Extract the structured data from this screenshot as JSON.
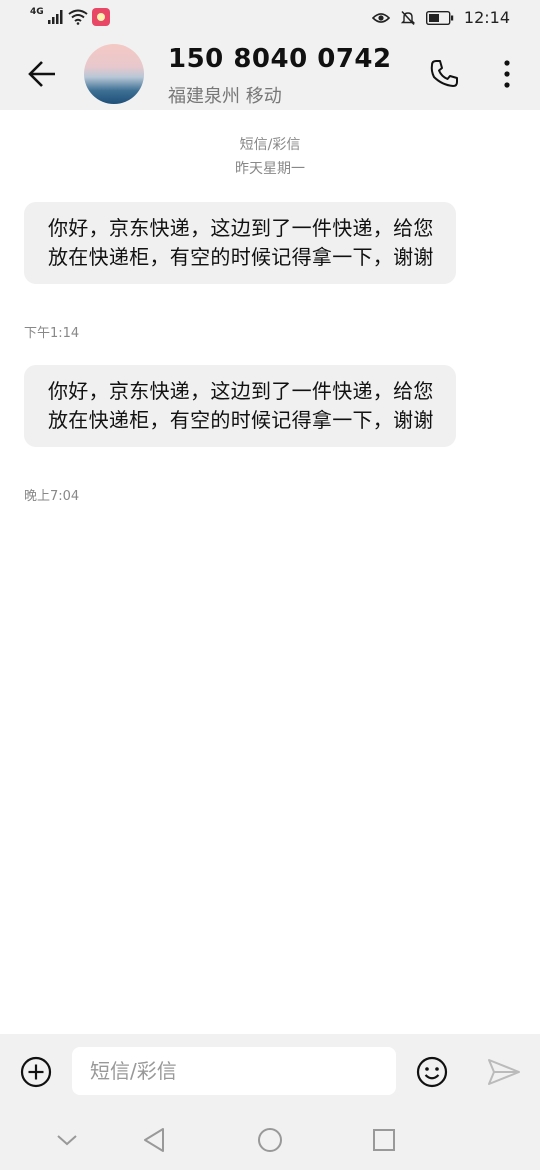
{
  "status_bar": {
    "network": "4G",
    "time": "12:14"
  },
  "header": {
    "contact_number": "150 8040 0742",
    "contact_location": "福建泉州 移动"
  },
  "conversation": {
    "type_label": "短信/彩信",
    "date_label": "昨天星期一",
    "messages": [
      {
        "text": "你好，京东快递，这边到了一件快递，给您放在快递柜，有空的时候记得拿一下，谢谢",
        "time": "下午1:14"
      },
      {
        "text": "你好，京东快递，这边到了一件快递，给您放在快递柜，有空的时候记得拿一下，谢谢",
        "time": "晚上7:04"
      }
    ]
  },
  "input_bar": {
    "placeholder": "短信/彩信",
    "value": ""
  },
  "icons": {
    "back": "arrow-left-icon",
    "call": "phone-icon",
    "more": "more-vertical-icon",
    "add": "plus-circle-icon",
    "emoji": "smiley-icon",
    "send": "send-icon",
    "nav_collapse": "chevron-down-icon",
    "nav_back": "triangle-back-icon",
    "nav_home": "circle-home-icon",
    "nav_recents": "square-recents-icon"
  },
  "colors": {
    "bar_background": "#f1f1f1",
    "bubble_background": "#f0f0f0",
    "secondary_text": "#888888"
  }
}
